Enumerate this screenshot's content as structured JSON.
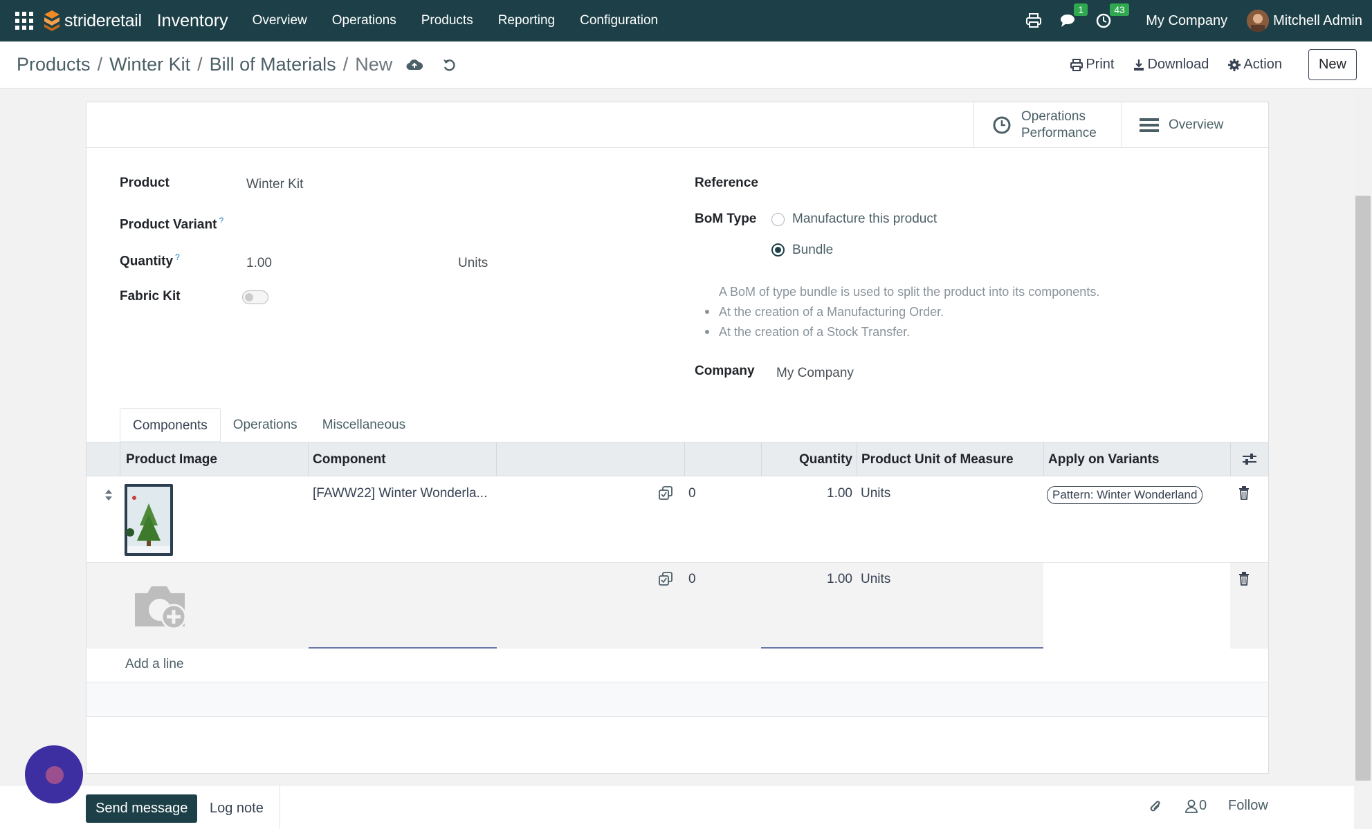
{
  "navbar": {
    "brand": "strideretail",
    "app_name": "Inventory",
    "menu": [
      "Overview",
      "Operations",
      "Products",
      "Reporting",
      "Configuration"
    ],
    "messages_badge": "1",
    "activities_badge": "43",
    "company": "My Company",
    "user": "Mitchell Admin"
  },
  "breadcrumb": {
    "items": [
      "Products",
      "Winter Kit",
      "Bill of Materials"
    ],
    "current": "New",
    "separator": "/"
  },
  "actions": {
    "print": "Print",
    "download": "Download",
    "action": "Action",
    "new": "New"
  },
  "smart_buttons": {
    "operations_performance": [
      "Operations",
      "Performance"
    ],
    "overview": "Overview"
  },
  "form": {
    "product_label": "Product",
    "product_value": "Winter Kit",
    "variant_label": "Product Variant",
    "quantity_label": "Quantity",
    "quantity_value": "1.00",
    "quantity_uom": "Units",
    "fabric_kit_label": "Fabric Kit",
    "help_mark": "?",
    "reference_label": "Reference",
    "bom_type_label": "BoM Type",
    "bom_type_options": [
      "Manufacture this product",
      "Bundle"
    ],
    "bom_type_selected": "Bundle",
    "bundle_help": "A BoM of type bundle is used to split the product into its components.",
    "bundle_help_items": [
      "At the creation of a Manufacturing Order.",
      "At the creation of a Stock Transfer."
    ],
    "company_label": "Company",
    "company_value": "My Company"
  },
  "tabs": [
    "Components",
    "Operations",
    "Miscellaneous"
  ],
  "table": {
    "headers": [
      "Product Image",
      "Component",
      "Quantity",
      "Product Unit of Measure",
      "Apply on Variants"
    ],
    "rows": [
      {
        "component": "[FAWW22] Winter Wonderla...",
        "forecast": "0",
        "quantity": "1.00",
        "uom": "Units",
        "variant_tag": "Pattern: Winter Wonderland"
      },
      {
        "component": "",
        "forecast": "0",
        "quantity": "1.00",
        "uom": "Units",
        "variant_tag": ""
      }
    ],
    "add_line": "Add a line"
  },
  "chatter": {
    "send_message": "Send message",
    "log_note": "Log note",
    "followers_count": "0",
    "follow": "Follow"
  },
  "colors": {
    "navbar": "#1d4048",
    "badge": "#2fa84f",
    "primary_button": "#1d4048"
  }
}
